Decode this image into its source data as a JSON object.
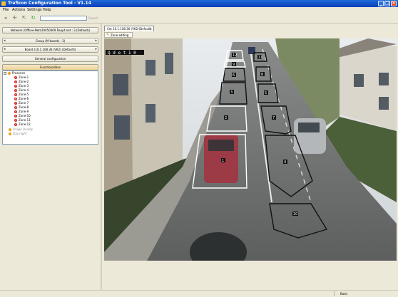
{
  "window": {
    "title": "Traficon Configuration Tool - V1.14"
  },
  "menu": [
    "File",
    "Actions",
    "Settings",
    "Help"
  ],
  "toolbar": {
    "search_value": "",
    "search_label": "Search"
  },
  "left": {
    "network": "Network (Offline-Netz20050409 Raupt.net : 3 (Default))",
    "group": "Group (M boards : 3)",
    "board": "Board (10.1.108.36 (VK2) (Default))",
    "general": "General configuration",
    "functionalities": "Functionalities"
  },
  "tree": {
    "presence": "Presence",
    "zones": [
      "Zone-1",
      "Zone-2",
      "Zone-3",
      "Zone-4",
      "Zone-5",
      "Zone-6",
      "Zone-7",
      "Zone-8",
      "Zone-9",
      "Zone-10",
      "Zone-11",
      "Zone-12"
    ],
    "extra": [
      "Image Quality",
      "Day-night"
    ]
  },
  "right": {
    "tab": "Cet 10.1.108.36 (VK2)(Default)",
    "subtab": "Zone editing"
  },
  "video": {
    "osd_text": "Q d e t 1 0",
    "zone_labels": [
      "1",
      "2",
      "3",
      "4",
      "5",
      "6",
      "7",
      "8",
      "9",
      "10",
      "11",
      "12"
    ]
  },
  "status": {
    "mode": "Basic"
  }
}
